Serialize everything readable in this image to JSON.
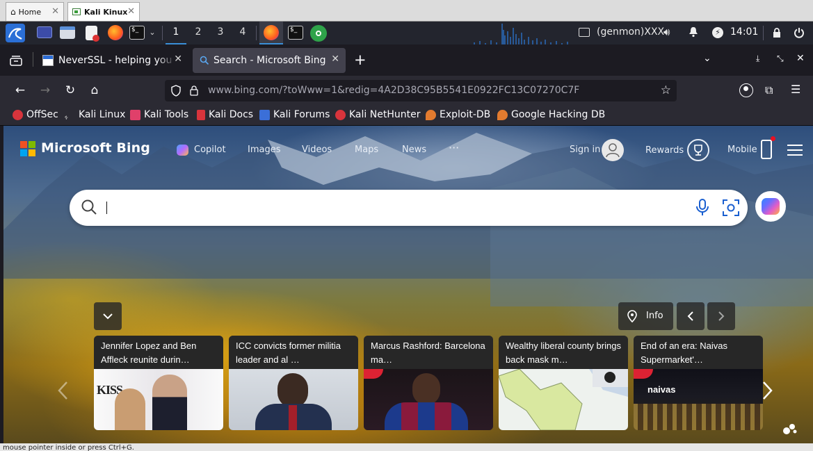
{
  "host": {
    "tabs": [
      {
        "label": "Home"
      },
      {
        "label": "Kali Kinux"
      }
    ]
  },
  "panel": {
    "workspaces": [
      "1",
      "2",
      "3",
      "4"
    ],
    "genmon": "(genmon)XXX",
    "clock": "14:01"
  },
  "browser": {
    "tabs": [
      {
        "label": "NeverSSL - helping you get online"
      },
      {
        "label": "Search - Microsoft Bing"
      }
    ],
    "url_host": "www.bing.com",
    "url_path": "/?toWww=1&redig=4A2D38C95B5541E0922FC13C07270C7F",
    "bookmarks": [
      {
        "label": "OffSec",
        "icon": "offsec-icon",
        "color": "#d8343c"
      },
      {
        "label": "Kali Linux",
        "icon": "kali-dragon-icon",
        "color": "#dddddd"
      },
      {
        "label": "Kali Tools",
        "icon": "kali-tools-icon",
        "color": "#e0406a"
      },
      {
        "label": "Kali Docs",
        "icon": "kali-docs-icon",
        "color": "#d8343c"
      },
      {
        "label": "Kali Forums",
        "icon": "kali-forums-icon",
        "color": "#3b6fd8"
      },
      {
        "label": "Kali NetHunter",
        "icon": "nethunter-icon",
        "color": "#d8343c"
      },
      {
        "label": "Exploit-DB",
        "icon": "exploit-db-icon",
        "color": "#e37b2f"
      },
      {
        "label": "Google Hacking DB",
        "icon": "ghdb-icon",
        "color": "#e37b2f"
      }
    ]
  },
  "bing": {
    "logo": "Microsoft Bing",
    "nav": [
      "Copilot",
      "Images",
      "Videos",
      "Maps",
      "News"
    ],
    "more": "···",
    "sign_in": "Sign in",
    "rewards": "Rewards",
    "mobile": "Mobile",
    "info": "Info",
    "news": [
      {
        "title": "Jennifer Lopez and Ben Affleck reunite durin…",
        "image": "celebrity-couple-photo"
      },
      {
        "title": "ICC convicts former militia leader and al …",
        "image": "man-in-suit-photo"
      },
      {
        "title": "Marcus Rashford: Barcelona ma…",
        "image": "football-player-photo"
      },
      {
        "title": "Wealthy liberal county brings back mask m…",
        "image": "county-map-photo"
      },
      {
        "title": "End of an era: Naivas Supermarket'…",
        "image": "supermarket-night-photo"
      }
    ]
  },
  "status": {
    "text": "mouse pointer inside or press Ctrl+G."
  }
}
